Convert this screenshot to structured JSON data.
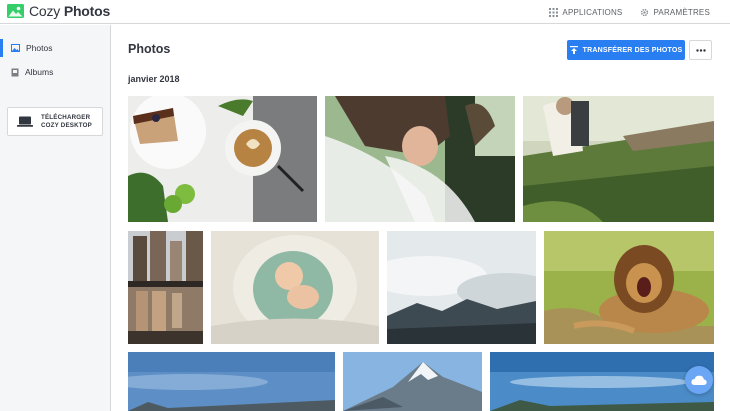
{
  "app": {
    "brand_light": "Cozy",
    "brand_bold": "Photos"
  },
  "topbar": {
    "applications_label": "APPLICATIONS",
    "settings_label": "PARAMÈTRES"
  },
  "sidebar": {
    "items": [
      {
        "label": "Photos",
        "icon": "photos-icon",
        "active": true
      },
      {
        "label": "Albums",
        "icon": "albums-icon",
        "active": false
      }
    ],
    "download": {
      "line1": "TÉLÉCHARGER",
      "line2": "COZY DESKTOP",
      "icon": "laptop-icon"
    }
  },
  "main": {
    "title": "Photos",
    "upload_label": "TRANSFÉRER DES PHOTOS",
    "more_icon": "more-dots-icon",
    "section_title": "janvier 2018"
  },
  "photos": [
    {
      "name": "coffee-and-cake",
      "subject": "coffee"
    },
    {
      "name": "bride-veil",
      "subject": "bride"
    },
    {
      "name": "couple-bench",
      "subject": "couple"
    },
    {
      "name": "city-reflection",
      "subject": "city"
    },
    {
      "name": "baby-blanket",
      "subject": "baby"
    },
    {
      "name": "misty-mountain",
      "subject": "mist"
    },
    {
      "name": "lion-roaring",
      "subject": "lion"
    },
    {
      "name": "mountain-sky-1",
      "subject": "sky"
    },
    {
      "name": "snowy-peak",
      "subject": "peak"
    },
    {
      "name": "lake-sky",
      "subject": "lake"
    }
  ],
  "colors": {
    "accent": "#297ef2",
    "sidebar_bg": "#f5f6f7",
    "border": "#d6d8da"
  }
}
